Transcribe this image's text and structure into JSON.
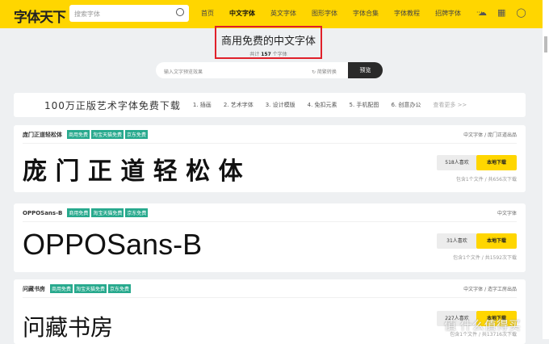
{
  "header": {
    "logo": "字体天下",
    "search_placeholder": "搜索字体",
    "nav": [
      "首页",
      "中文字体",
      "英文字体",
      "图形字体",
      "字体合集",
      "字体教程",
      "招牌字体",
      "···"
    ]
  },
  "page": {
    "title": "商用免费的中文字体",
    "count_prefix": "共计",
    "count": "157",
    "count_suffix": "个字体"
  },
  "preview": {
    "placeholder": "输入文字预览效果",
    "convert": "↻ 简繁转换",
    "button": "预览"
  },
  "banner": {
    "title": "100万正版艺术字体免费下载",
    "items": [
      "1. 插画",
      "2. 艺术字体",
      "3. 设计模版",
      "4. 免扣元素",
      "5. 手机配图",
      "6. 创意办公"
    ],
    "more": "查看更多 >>"
  },
  "fonts": [
    {
      "name": "庞门正道轻松体",
      "tags": [
        "商用免费",
        "淘宝天猫免费",
        "京东免费"
      ],
      "category": "中文字体 / 庞门正道出品",
      "sample": "庞 门 正 道 轻 松 体",
      "likes": "518人喜欢",
      "download": "本地下载",
      "info": "包含1个文件 / 共656次下载"
    },
    {
      "name": "OPPOSans-B",
      "tags": [
        "商用免费",
        "淘宝天猫免费",
        "京东免费"
      ],
      "category": "中文字体",
      "sample": "OPPOSans-B",
      "likes": "31人喜欢",
      "download": "本地下载",
      "info": "包含1个文件 / 共1592次下载"
    },
    {
      "name": "问藏书房",
      "tags": [
        "商用免费",
        "淘宝天猫免费",
        "京东免费"
      ],
      "category": "中文字体 / 造字工房出品",
      "sample": "问藏书房",
      "likes": "227人喜欢",
      "download": "本地下载",
      "info": "包含1个文件 / 共13716次下载"
    }
  ],
  "watermark": "值 什么值得买"
}
